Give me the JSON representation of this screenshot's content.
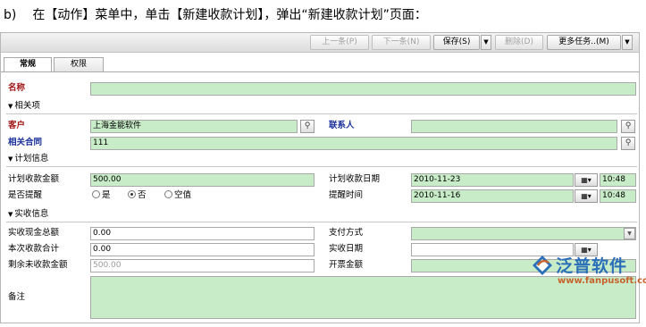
{
  "caption": {
    "label": "b)",
    "text": "在【动作】菜单中，单击【新建收款计划】，弹出“新建收款计划”页面："
  },
  "toolbar": {
    "prev": "上一条(P)",
    "next": "下一条(N)",
    "save": "保存(S)",
    "delete": "删除(D)",
    "more": "更多任务..(M)"
  },
  "tabs": [
    "常规",
    "权限"
  ],
  "form": {
    "name_label": "名称",
    "name_value": "",
    "related_section": "相关项",
    "customer_label": "客户",
    "customer_value": "上海金能软件",
    "contact_label": "联系人",
    "contact_value": "",
    "contract_label": "相关合同",
    "contract_value": "111",
    "plan_section": "计划信息",
    "plan_amount_label": "计划收款金额",
    "plan_amount_value": "500.00",
    "plan_date_label": "计划收款日期",
    "plan_date_value": "2010-11-23",
    "plan_time_value": "10:48",
    "remind_label": "是否提醒",
    "remind_options": [
      "是",
      "否",
      "空值"
    ],
    "remind_selected": "否",
    "remind_time_label": "提醒时间",
    "remind_date_value": "2010-11-16",
    "remind_time_value": "10:48",
    "actual_section": "实收信息",
    "cash_label": "实收现金总额",
    "cash_value": "0.00",
    "pay_method_label": "支付方式",
    "pay_method_value": "",
    "this_total_label": "本次收款合计",
    "this_total_value": "0.00",
    "actual_date_label": "实收日期",
    "actual_date_value": "",
    "remaining_label": "剩余未收款金额",
    "remaining_value": "500.00",
    "invoice_label": "开票金额",
    "invoice_value": "",
    "remark_label": "备注",
    "remark_value": ""
  },
  "logo": {
    "name": "泛普软件",
    "url": "www.fanpusoft.com"
  },
  "colors": {
    "field_green": "#c7ecc7",
    "required_red": "#a01818",
    "required_blue": "#1a2f9a",
    "logo_blue": "#2a6fb8",
    "logo_orange": "#c7622d"
  },
  "icons": {
    "lookup": "magnifier-icon",
    "calendar": "calendar-icon",
    "dropdown": "chevron-down-icon",
    "section": "triangle-down-icon"
  }
}
